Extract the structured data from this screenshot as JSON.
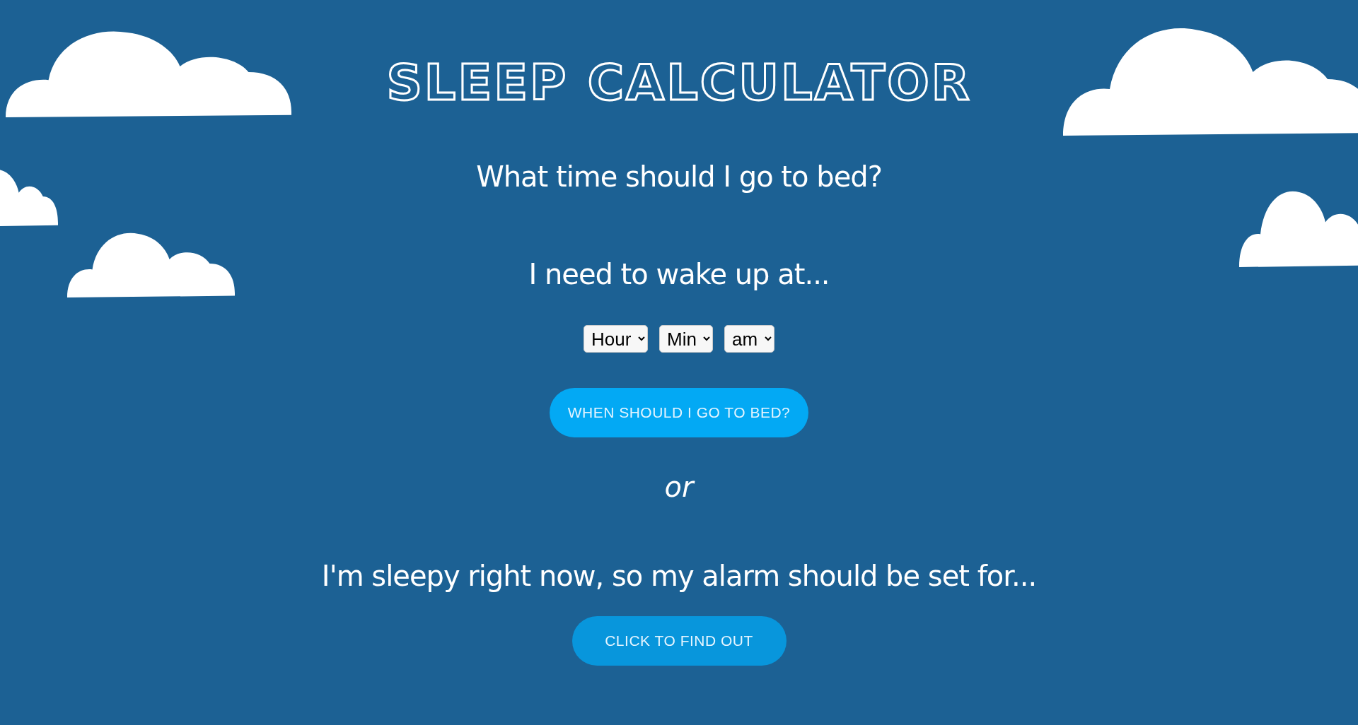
{
  "title": "SLEEP CALCULATOR",
  "question": "What time should I go to bed?",
  "wake_prompt": "I need to wake up at...",
  "selects": [
    {
      "value": "Hour"
    },
    {
      "value": "Min"
    },
    {
      "value": "am"
    }
  ],
  "bed_button": "WHEN SHOULD I GO TO BED?",
  "separator": "or",
  "sleepy_prompt": "I'm sleepy right now, so my alarm should be set for...",
  "find_button": "CLICK TO FIND OUT"
}
